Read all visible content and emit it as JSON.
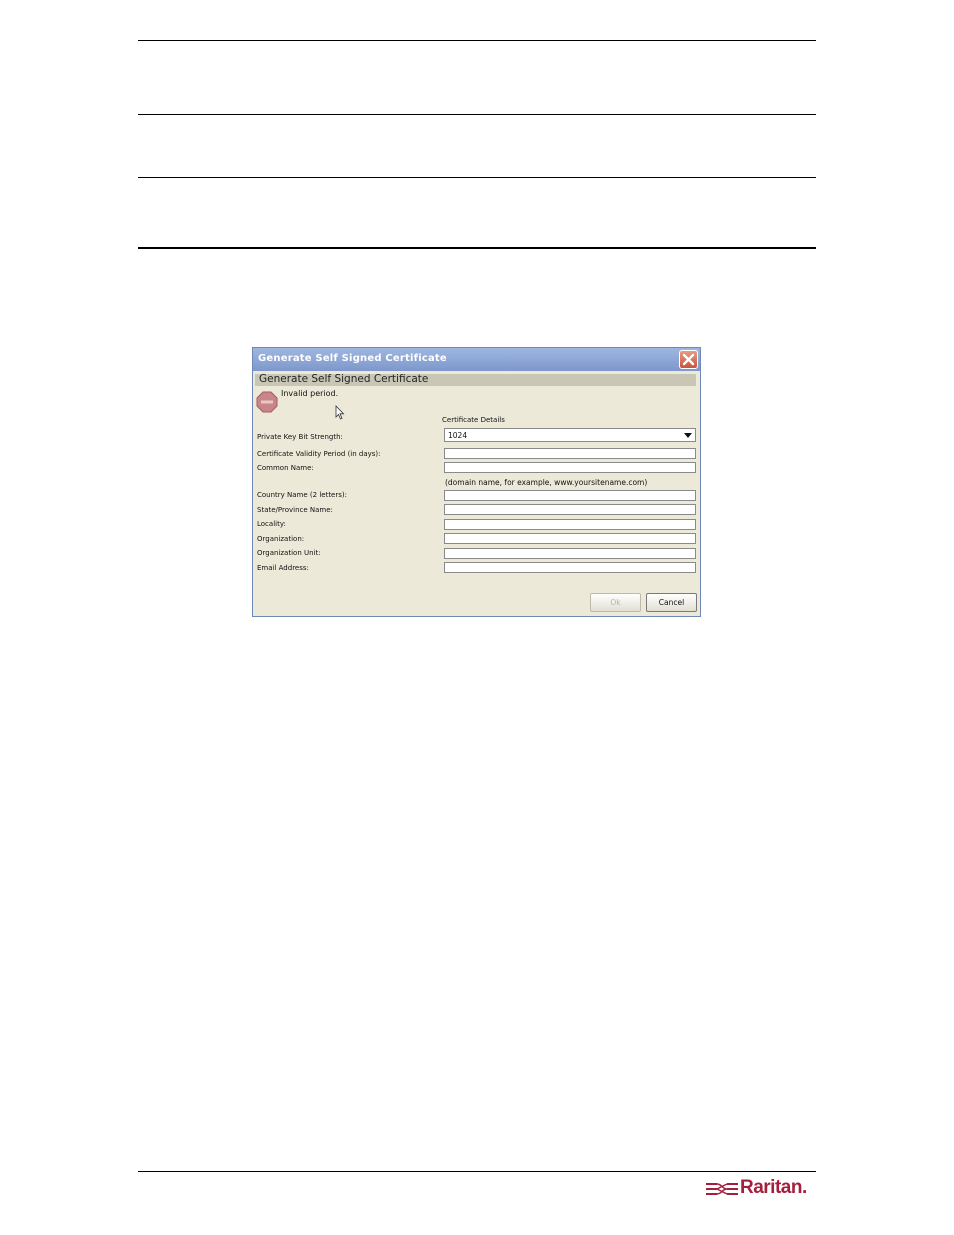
{
  "dialog": {
    "title": "Generate Self Signed Certificate",
    "header": "Generate Self Signed Certificate",
    "error": "Invalid period.",
    "section_label": "Certificate Details",
    "fields": {
      "key_strength": {
        "label": "Private Key Bit Strength:",
        "value": "1024"
      },
      "validity": {
        "label": "Certificate Validity Period (in days):",
        "value": ""
      },
      "common_name": {
        "label": "Common Name:",
        "value": "",
        "hint": "(domain name, for example, www.yoursitename.com)"
      },
      "country": {
        "label": "Country Name (2 letters):",
        "value": ""
      },
      "state": {
        "label": "State/Province Name:",
        "value": ""
      },
      "locality": {
        "label": "Locality:",
        "value": ""
      },
      "organization": {
        "label": "Organization:",
        "value": ""
      },
      "org_unit": {
        "label": "Organization Unit:",
        "value": ""
      },
      "email": {
        "label": "Email Address:",
        "value": ""
      }
    },
    "buttons": {
      "ok": "Ok",
      "cancel": "Cancel"
    }
  },
  "footer": {
    "logo_text": "Raritan.",
    "logo_color": "#a31f3d"
  },
  "icons": [
    "close-icon",
    "stop-error-icon",
    "dropdown-arrow-icon",
    "mouse-cursor-icon",
    "raritan-logo-icon"
  ]
}
